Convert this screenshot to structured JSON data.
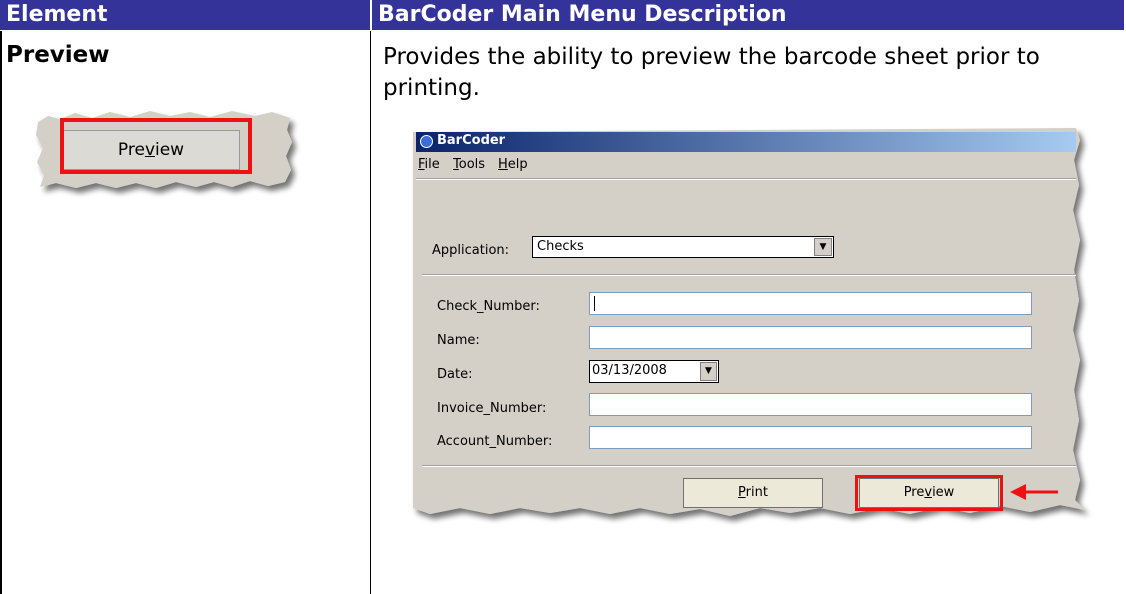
{
  "table": {
    "header_left": "Element",
    "header_right": "BarCoder Main Menu Description"
  },
  "row": {
    "element": "Preview",
    "description": "Provides the ability to preview the barcode sheet prior to printing."
  },
  "small_shot": {
    "button_label_parts": [
      "Pre",
      "v",
      "iew"
    ]
  },
  "window": {
    "title": "BarCoder",
    "menu": {
      "file": [
        "F",
        "ile"
      ],
      "tools": [
        "T",
        "ools"
      ],
      "help": [
        "H",
        "elp"
      ]
    },
    "application_label": "Application:",
    "application_value": "Checks",
    "fields": [
      {
        "label": "Check_Number:",
        "value": ""
      },
      {
        "label": "Name:",
        "value": ""
      },
      {
        "label": "Date:",
        "value": "03/13/2008"
      },
      {
        "label": "Invoice_Number:",
        "value": ""
      },
      {
        "label": "Account_Number:",
        "value": ""
      }
    ],
    "print_button": [
      "P",
      "rint"
    ],
    "preview_button": [
      "Pre",
      "v",
      "iew"
    ]
  },
  "colors": {
    "header_bg": "#333399",
    "highlight": "#ee1111",
    "window_bg": "#d4d0c8",
    "titlebar": "#0a246a"
  }
}
